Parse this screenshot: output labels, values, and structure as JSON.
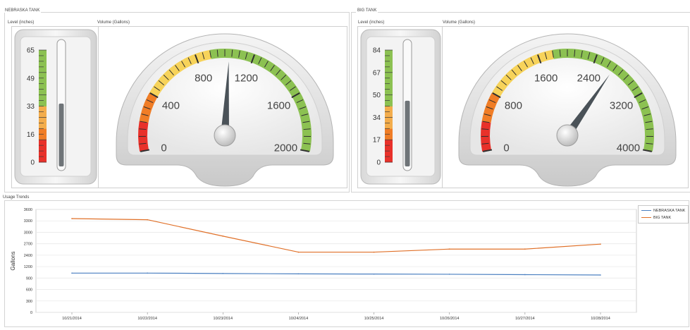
{
  "tanks": [
    {
      "title": "NEBRASKA TANK",
      "level_label": "Level (inches)",
      "volume_label": "Volume (Gallons)",
      "level_ticks": [
        "65",
        "49",
        "33",
        "16",
        "0"
      ],
      "level_max": 65,
      "level_value": 34,
      "volume_ticks": [
        "0",
        "400",
        "800",
        "1200",
        "1600",
        "2000"
      ],
      "volume_max": 2000,
      "volume_value": 1030
    },
    {
      "title": "BIG TANK",
      "level_label": "Level (inches)",
      "volume_label": "Volume (Gallons)",
      "level_ticks": [
        "84",
        "67",
        "50",
        "34",
        "17",
        "0"
      ],
      "level_max": 84,
      "level_value": 46,
      "volume_ticks": [
        "0",
        "800",
        "1600",
        "2400",
        "3200",
        "4000"
      ],
      "volume_max": 4000,
      "volume_value": 2690
    }
  ],
  "trends": {
    "title": "Usage Trends"
  },
  "colors": {
    "nebraska_series": "#4a7fc0",
    "big_series": "#e07028",
    "gauge_red": "#e8312a",
    "gauge_orange": "#f07d26",
    "gauge_yellow": "#f7d35a",
    "gauge_green": "#8cc152"
  },
  "chart_data": {
    "type": "line",
    "categories": [
      "10/21/2014",
      "10/22/2014",
      "10/23/2014",
      "10/24/2014",
      "10/25/2014",
      "10/26/2014",
      "10/27/2014",
      "10/28/2014"
    ],
    "ylabel": "Gallons",
    "ylim": [
      0,
      3600
    ],
    "yticks": [
      "0",
      "300",
      "600",
      "900",
      "1200",
      "2400",
      "2700",
      "3000",
      "3300",
      "3600"
    ],
    "legend_position": "top-right",
    "grid": true,
    "series": [
      {
        "name": "NEBRASKA TANK",
        "values": [
          1030,
          1030,
          1020,
          1010,
          1005,
          1000,
          990,
          980
        ]
      },
      {
        "name": "BIG TANK",
        "values": [
          3360,
          3330,
          2900,
          2480,
          2480,
          2560,
          2560,
          2690
        ]
      }
    ]
  }
}
